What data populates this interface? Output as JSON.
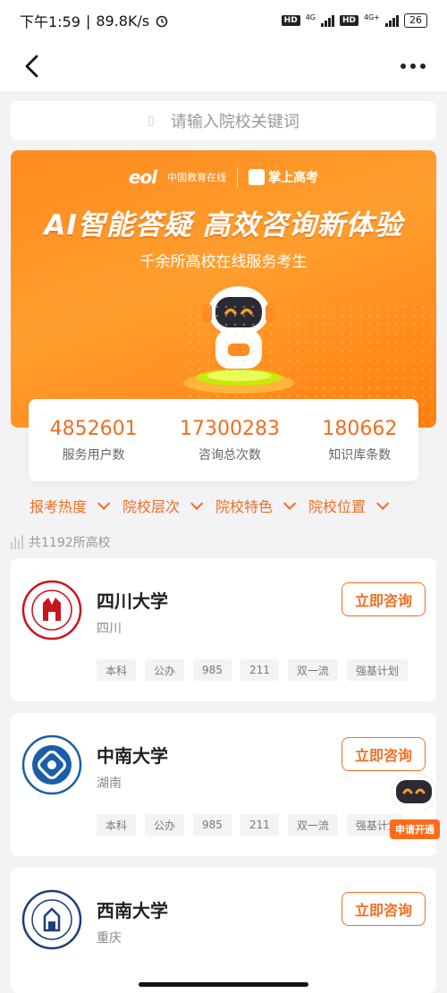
{
  "status_bar": {
    "time": "下午1:59",
    "speed": "89.8K/s",
    "hd1": "HD",
    "net1": "4G",
    "hd2": "HD",
    "net2": "4G+",
    "battery": "26"
  },
  "search": {
    "placeholder": "请输入院校关键词"
  },
  "banner": {
    "logo_left": "eol",
    "logo_left_text": "中国教育在线",
    "logo_right": "掌上高考",
    "title": "AI智能答疑 高效咨询新体验",
    "subtitle": "千余所高校在线服务考生"
  },
  "stats": [
    {
      "value": "4852601",
      "label": "服务用户数"
    },
    {
      "value": "17300283",
      "label": "咨询总次数"
    },
    {
      "value": "180662",
      "label": "知识库条数"
    }
  ],
  "filters": [
    "报考热度",
    "院校层次",
    "院校特色",
    "院校位置"
  ],
  "count_text": "共1192所高校",
  "consult_label": "立即咨询",
  "float_button": "申请开通",
  "schools": [
    {
      "name": "四川大学",
      "location": "四川",
      "tags": [
        "本科",
        "公办",
        "985",
        "211",
        "双一流",
        "强基计划"
      ]
    },
    {
      "name": "中南大学",
      "location": "湖南",
      "tags": [
        "本科",
        "公办",
        "985",
        "211",
        "双一流",
        "强基计划"
      ]
    },
    {
      "name": "西南大学",
      "location": "重庆",
      "tags": []
    }
  ],
  "colors": {
    "accent": "#f26d1f",
    "background": "#f3f3f5"
  }
}
